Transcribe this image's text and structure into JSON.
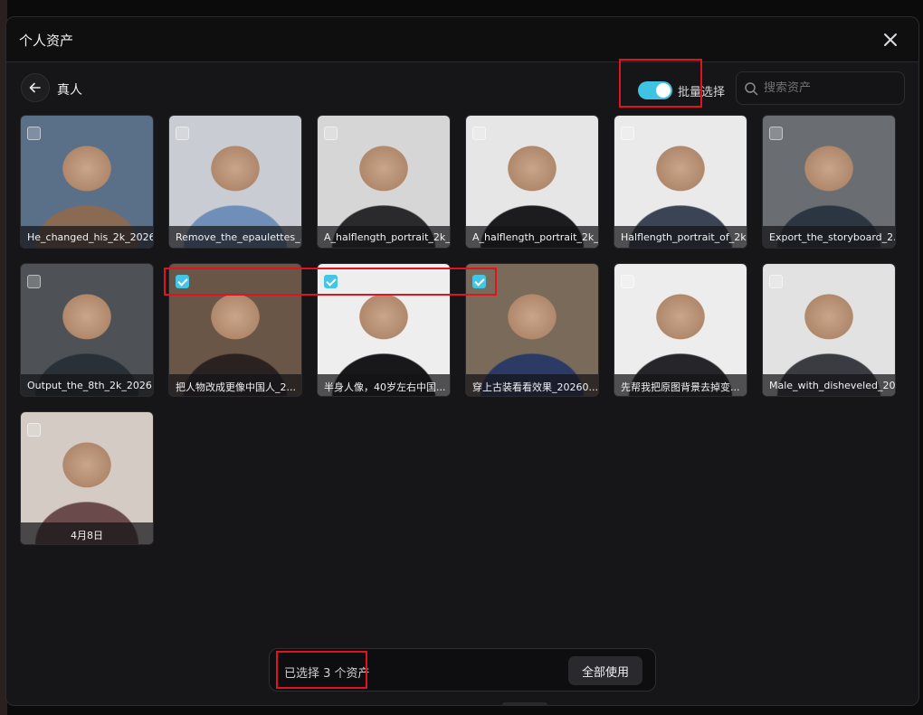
{
  "dialog": {
    "title": "个人资产"
  },
  "toolbar": {
    "folder_name": "真人",
    "batch_select_label": "批量选择",
    "batch_select_on": true,
    "search_placeholder": "搜索资产"
  },
  "assets": [
    {
      "caption": "He_changed_his_2k_2026...",
      "checked": false,
      "palette": [
        "#5a7088",
        "#8a6a52"
      ]
    },
    {
      "caption": "Remove_the_epaulettes_...",
      "checked": false,
      "palette": [
        "#c9ccd2",
        "#6f8fb8"
      ]
    },
    {
      "caption": "A_halflength_portrait_2k_...",
      "checked": false,
      "palette": [
        "#d6d6d6",
        "#2a2a2c"
      ]
    },
    {
      "caption": "A_halflength_portrait_2k_...",
      "checked": false,
      "palette": [
        "#e6e6e6",
        "#1c1c1e"
      ]
    },
    {
      "caption": "Halflength_portrait_of_2k...",
      "checked": false,
      "palette": [
        "#eaeaea",
        "#3a4454"
      ]
    },
    {
      "caption": "Export_the_storyboard_2...",
      "checked": false,
      "palette": [
        "#6a6e72",
        "#2c3642"
      ]
    },
    {
      "caption": "Output_the_8th_2k_2026...",
      "checked": false,
      "palette": [
        "#4e5256",
        "#2a3038"
      ]
    },
    {
      "caption": "把人物改成更像中国人_2...",
      "checked": true,
      "palette": [
        "#6a5646",
        "#2a2220"
      ]
    },
    {
      "caption": "半身人像，40岁左右中国...",
      "checked": true,
      "palette": [
        "#eeeeee",
        "#18181a"
      ]
    },
    {
      "caption": "穿上古装看看效果_20260...",
      "checked": true,
      "palette": [
        "#7a6a5a",
        "#2c3a66"
      ]
    },
    {
      "caption": "先帮我把原图背景去掉变...",
      "checked": false,
      "palette": [
        "#ededed",
        "#26262a"
      ]
    },
    {
      "caption": "Male_with_disheveled_20...",
      "checked": false,
      "palette": [
        "#e2e2e2",
        "#3a3c42"
      ]
    },
    {
      "caption": "4月8日",
      "checked": false,
      "palette": [
        "#d4ccc4",
        "#6a4a4a"
      ],
      "center": true
    }
  ],
  "footer": {
    "selected_text": "已选择 3 个资产",
    "use_all_label": "全部使用"
  },
  "colors": {
    "accent": "#43c6e6",
    "highlight": "#e0141e",
    "background": "#161618"
  }
}
